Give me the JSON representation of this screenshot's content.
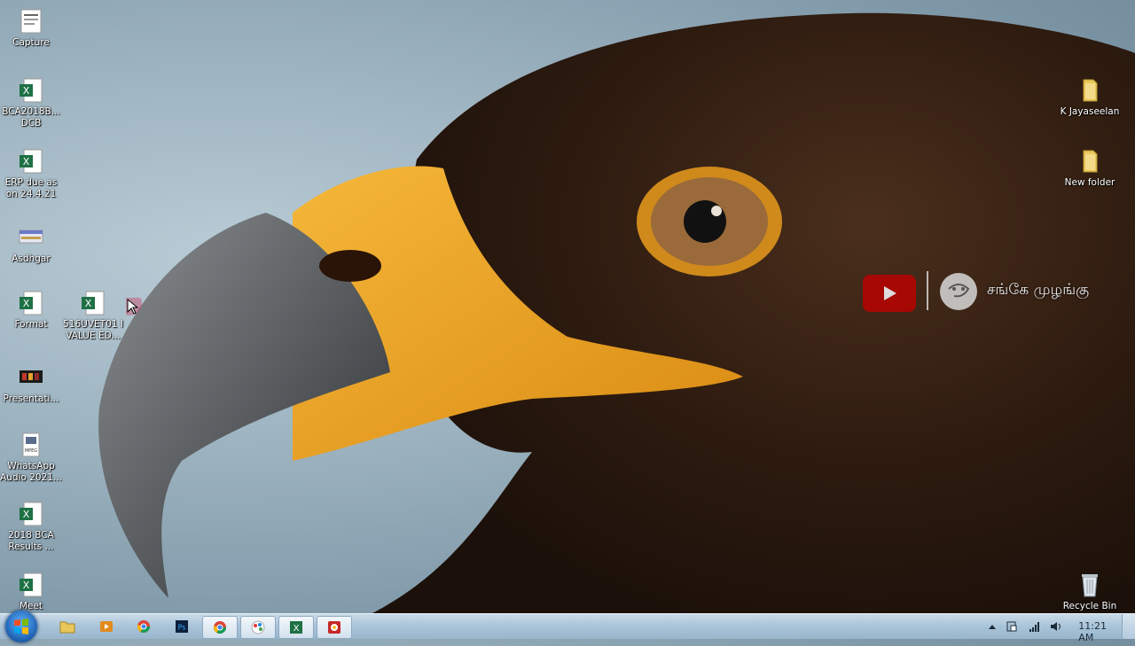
{
  "desktop": {
    "icons_left": [
      {
        "label": "Capture",
        "icon": "image-file-icon"
      },
      {
        "label": "BCA2018B... DCB",
        "icon": "excel-file-icon"
      },
      {
        "label": "ERP due as on 24.4.21",
        "icon": "excel-file-icon"
      },
      {
        "label": "Asdhgar",
        "icon": "image-file-icon"
      },
      {
        "label": "Format",
        "icon": "excel-file-icon"
      },
      {
        "label": "Presentati...",
        "icon": "media-file-icon"
      },
      {
        "label": "WhatsApp Audio 2021...",
        "icon": "audio-file-icon"
      },
      {
        "label": "2018 BCA Results ...",
        "icon": "excel-file-icon"
      },
      {
        "label": "Meet",
        "icon": "excel-file-icon"
      }
    ],
    "icon_col2": {
      "label": "516UVET01 I VALUE ED...",
      "icon": "excel-file-icon"
    },
    "icons_right": [
      {
        "label": "K Jayaseelan",
        "icon": "folder-icon"
      },
      {
        "label": "New folder",
        "icon": "folder-icon"
      },
      {
        "label": "Recycle Bin",
        "icon": "recycle-bin-icon"
      }
    ]
  },
  "watermark": {
    "channel_text": "சங்கே முழங்கு"
  },
  "taskbar": {
    "clock": "11:21 AM",
    "pinned": [
      "file-explorer-icon",
      "media-player-icon",
      "chrome-icon",
      "photoshop-icon",
      "chrome-icon",
      "paint-app-icon",
      "excel-icon",
      "chrome-canary-icon"
    ]
  },
  "colors": {
    "taskbar": "#a9c3d8",
    "excel_green": "#1e7145",
    "folder_yellow": "#e9c75a"
  }
}
